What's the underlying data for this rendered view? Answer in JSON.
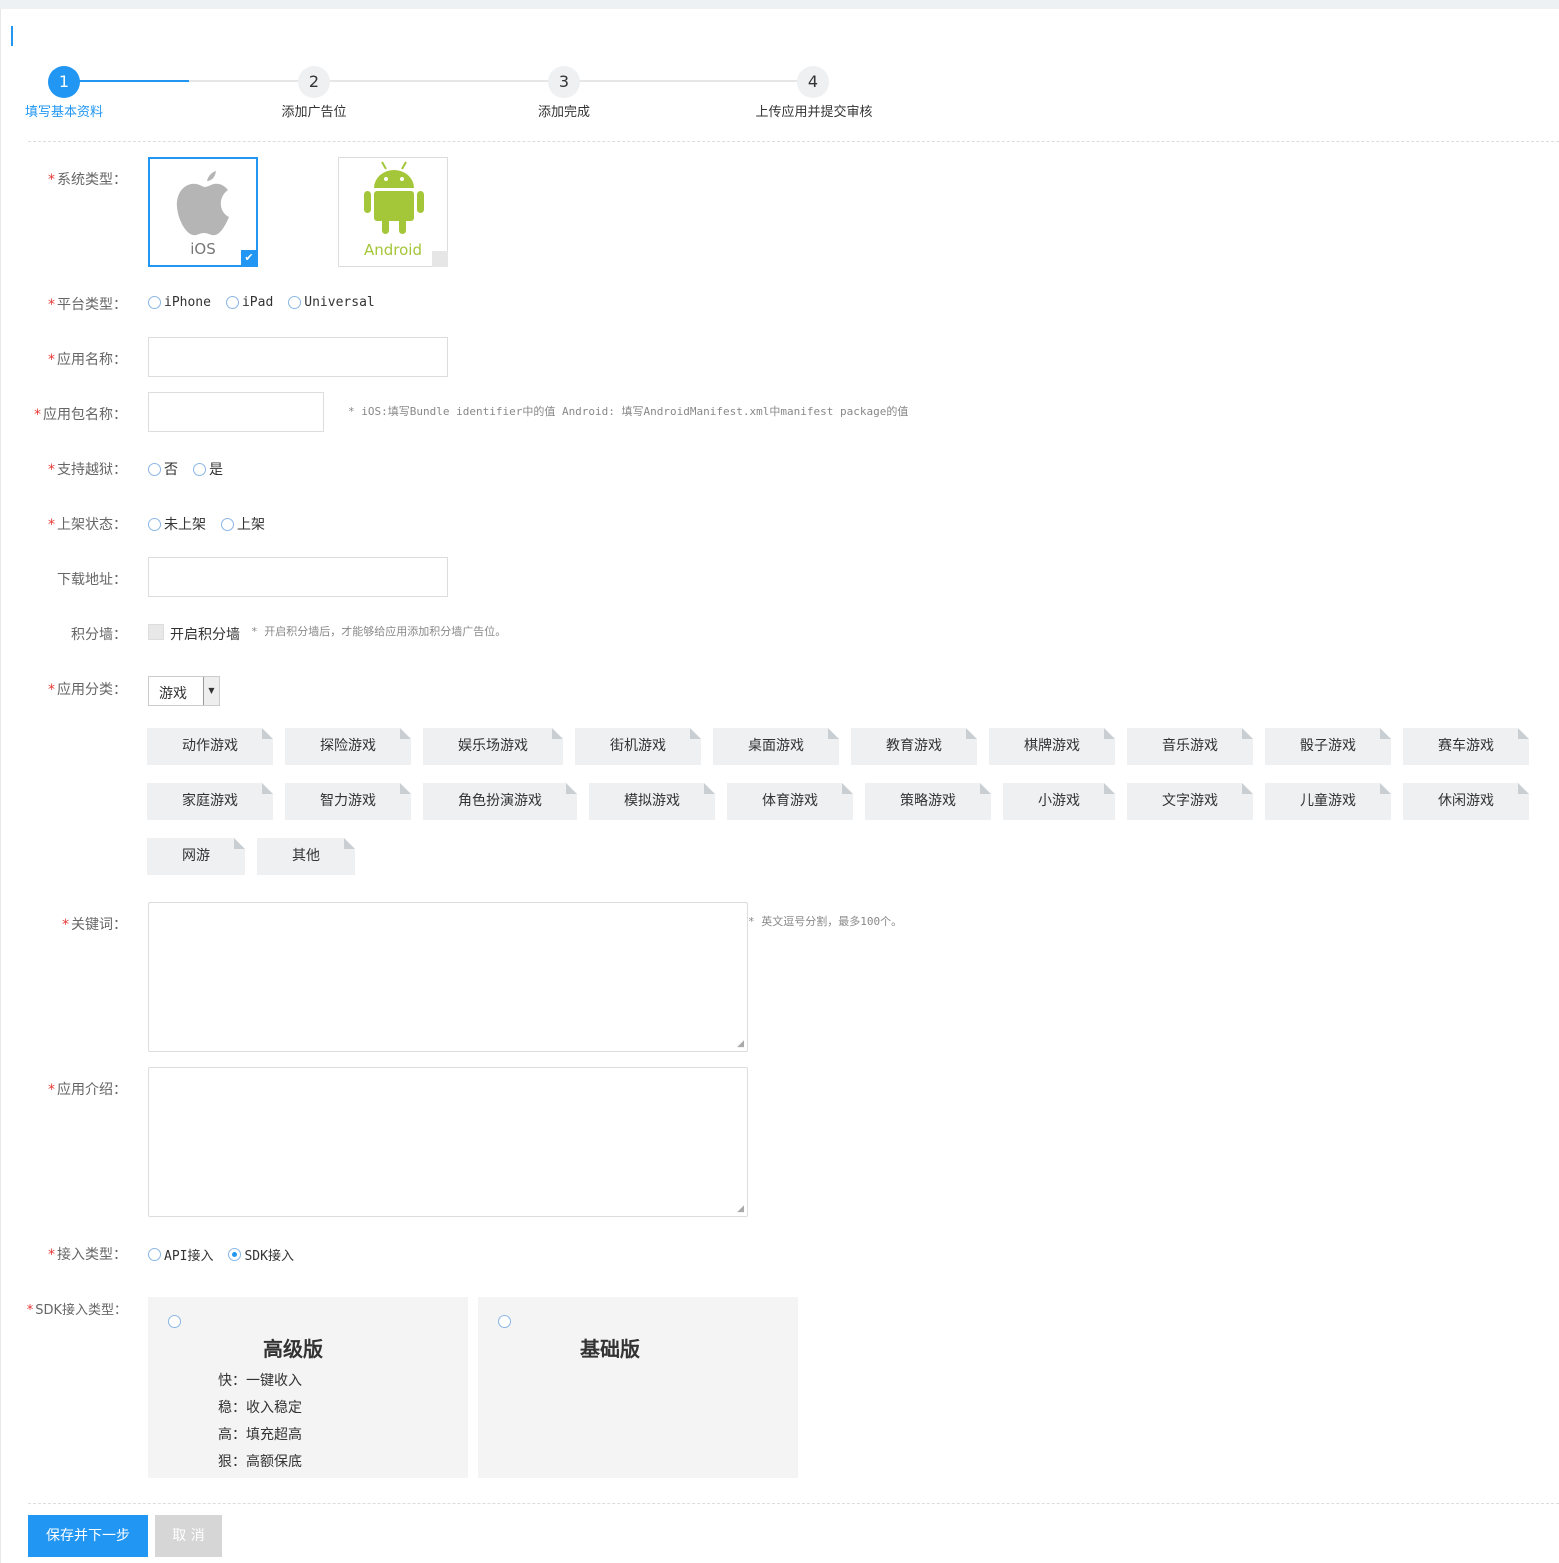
{
  "colors": {
    "accent": "#2196f3",
    "required_star": "#e53935",
    "android_green": "#a4c639",
    "apple_gray": "#b5b5b5"
  },
  "steps": [
    {
      "num": "1",
      "label": "填写基本资料",
      "active": true
    },
    {
      "num": "2",
      "label": "添加广告位",
      "active": false
    },
    {
      "num": "3",
      "label": "添加完成",
      "active": false
    },
    {
      "num": "4",
      "label": "上传应用并提交审核",
      "active": false
    }
  ],
  "required_mark": "*",
  "form": {
    "system_type": {
      "label": "系统类型：",
      "options": [
        {
          "name": "iOS",
          "icon": "apple-icon",
          "selected": true
        },
        {
          "name": "Android",
          "icon": "android-icon",
          "selected": false
        }
      ]
    },
    "platform": {
      "label": "平台类型：",
      "options": [
        "iPhone",
        "iPad",
        "Universal"
      ]
    },
    "app_name": {
      "label": "应用名称：",
      "value": ""
    },
    "package_name": {
      "label": "应用包名称：",
      "value": "",
      "hint": "* iOS:填写Bundle identifier中的值 Android: 填写AndroidManifest.xml中manifest package的值"
    },
    "jailbreak": {
      "label": "支持越狱：",
      "options": [
        "否",
        "是"
      ]
    },
    "listing": {
      "label": "上架状态：",
      "options": [
        "未上架",
        "上架"
      ]
    },
    "download_url": {
      "label": "下载地址：",
      "value": ""
    },
    "points_wall": {
      "label": "积分墙：",
      "checkbox_label": "开启积分墙",
      "hint": "* 开启积分墙后，才能够给应用添加积分墙广告位。"
    },
    "category": {
      "label": "应用分类：",
      "selected": "游戏",
      "tags": [
        "动作游戏",
        "探险游戏",
        "娱乐场游戏",
        "街机游戏",
        "桌面游戏",
        "教育游戏",
        "棋牌游戏",
        "音乐游戏",
        "骰子游戏",
        "赛车游戏",
        "家庭游戏",
        "智力游戏",
        "角色扮演游戏",
        "模拟游戏",
        "体育游戏",
        "策略游戏",
        "小游戏",
        "文字游戏",
        "儿童游戏",
        "休闲游戏",
        "网游",
        "其他"
      ]
    },
    "keywords": {
      "label": "关键词：",
      "value": "",
      "hint": "* 英文逗号分割，最多100个。"
    },
    "intro": {
      "label": "应用介绍：",
      "value": ""
    },
    "access_type": {
      "label": "接入类型：",
      "options": [
        {
          "name": "API接入",
          "selected": false
        },
        {
          "name": "SDK接入",
          "selected": true
        }
      ]
    },
    "sdk_type": {
      "label": "SDK接入类型：",
      "cards": [
        {
          "title": "高级版",
          "features": [
            "快：一键收入",
            "稳：收入稳定",
            "高：填充超高",
            "狠：高额保底"
          ]
        },
        {
          "title": "基础版",
          "features": []
        }
      ]
    }
  },
  "buttons": {
    "save": "保存并下一步",
    "cancel": "取 消"
  }
}
